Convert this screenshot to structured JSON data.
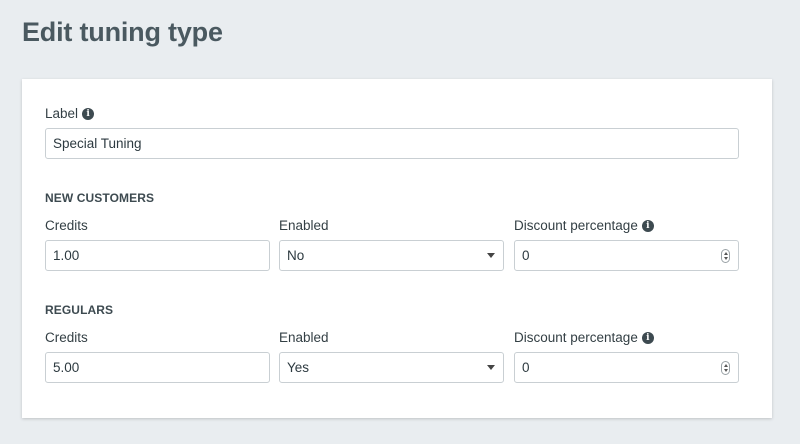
{
  "page": {
    "title": "Edit tuning type"
  },
  "label_field": {
    "label": "Label",
    "value": "Special Tuning"
  },
  "new_customers": {
    "heading": "NEW CUSTOMERS",
    "credits_label": "Credits",
    "credits_value": "1.00",
    "enabled_label": "Enabled",
    "enabled_value": "No",
    "discount_label": "Discount percentage",
    "discount_value": "0"
  },
  "regulars": {
    "heading": "REGULARS",
    "credits_label": "Credits",
    "credits_value": "5.00",
    "enabled_label": "Enabled",
    "enabled_value": "Yes",
    "discount_label": "Discount percentage",
    "discount_value": "0"
  },
  "icons": {
    "info": "info-circle-icon",
    "dropdown": "caret-down-icon",
    "stepper": "number-stepper-icon"
  },
  "colors": {
    "background": "#e9edf0",
    "card": "#ffffff",
    "title": "#4a5960",
    "border": "#c9cfd3"
  }
}
